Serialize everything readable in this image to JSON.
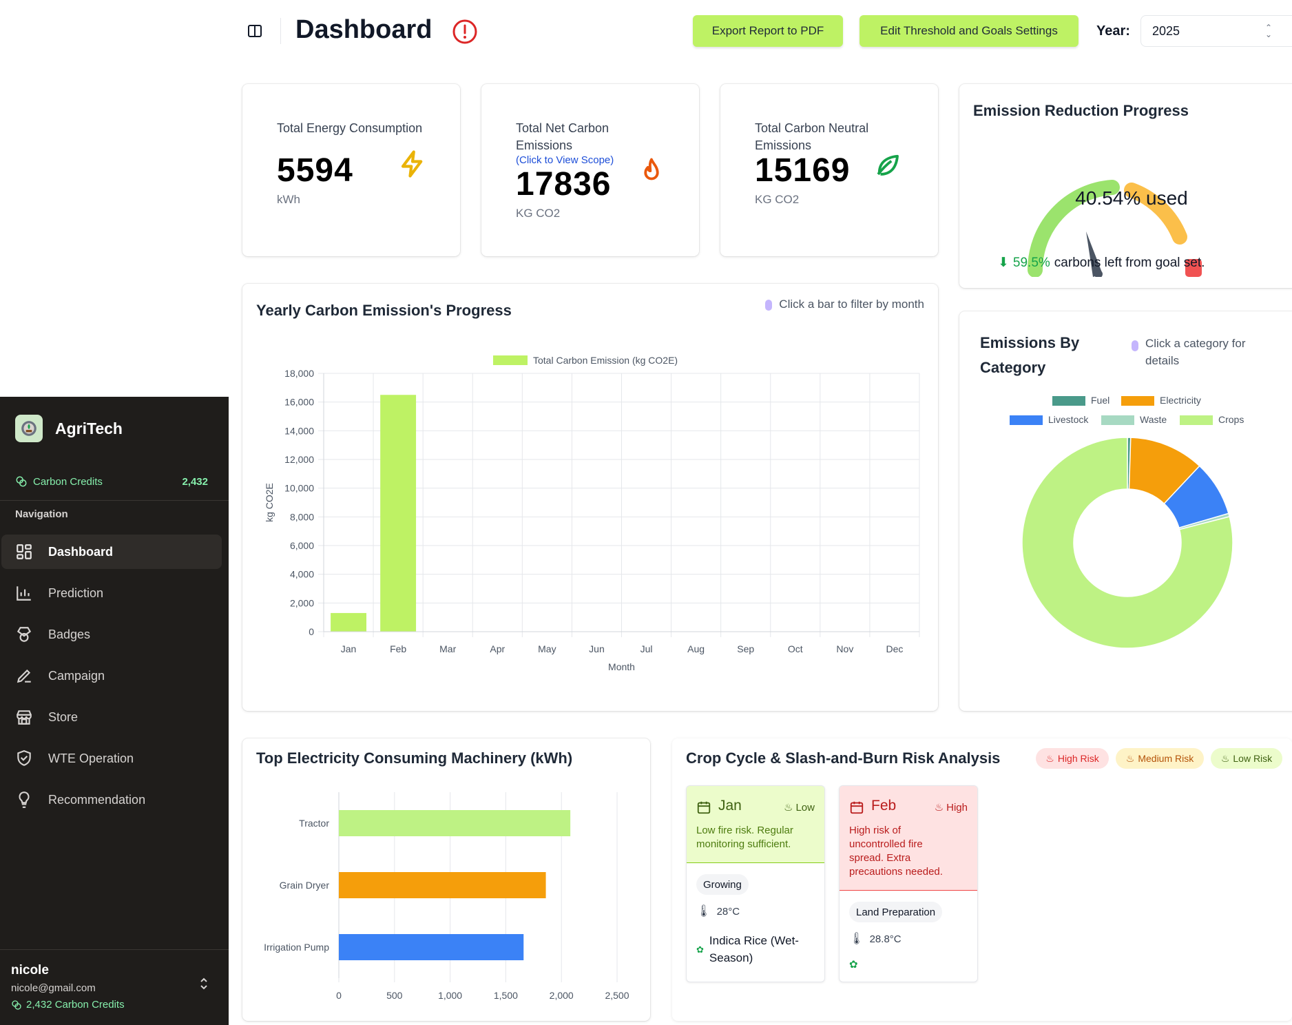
{
  "header": {
    "title": "Dashboard",
    "export_button": "Export Report to PDF",
    "settings_button": "Edit Threshold and Goals Settings",
    "year_label": "Year:",
    "year_value": "2025"
  },
  "sidebar": {
    "brand": "AgriTech",
    "credits_label": "Carbon Credits",
    "credits_value": "2,432",
    "nav_title": "Navigation",
    "items": [
      {
        "label": "Dashboard",
        "icon": "dashboard-icon",
        "active": true
      },
      {
        "label": "Prediction",
        "icon": "bar-chart-icon"
      },
      {
        "label": "Badges",
        "icon": "badge-icon"
      },
      {
        "label": "Campaign",
        "icon": "pen-icon"
      },
      {
        "label": "Store",
        "icon": "store-icon"
      },
      {
        "label": "WTE Operation",
        "icon": "handshake-shield-icon"
      },
      {
        "label": "Recommendation",
        "icon": "lightbulb-icon"
      }
    ],
    "user": {
      "name": "nicole",
      "email": "nicole@gmail.com",
      "credits": "2,432 Carbon Credits"
    }
  },
  "stats": {
    "energy": {
      "label": "Total Energy Consumption",
      "value": "5594",
      "unit": "kWh"
    },
    "net": {
      "label": "Total Net Carbon Emissions",
      "link": "(Click to View Scope)",
      "value": "17836",
      "unit": "KG CO2"
    },
    "neutral": {
      "label": "Total Carbon Neutral Emissions",
      "value": "15169",
      "unit": "KG CO2"
    }
  },
  "progress": {
    "title": "Emission Reduction Progress",
    "used_text": "40.54% used",
    "used_fraction": 0.4054,
    "left_pct": "59.5%",
    "left_text": "carbons left from goal set."
  },
  "yearly": {
    "title": "Yearly Carbon Emission's Progress",
    "hint": "Click a bar to filter by month"
  },
  "category": {
    "title_line1": "Emissions By",
    "title_line2": "Category",
    "hint": "Click a category for details"
  },
  "machinery": {
    "title": "Top Electricity Consuming Machinery (kWh)"
  },
  "crop": {
    "title": "Crop Cycle & Slash-and-Burn Risk Analysis",
    "pills": {
      "high": "High Risk",
      "medium": "Medium Risk",
      "low": "Low Risk"
    },
    "months": [
      {
        "month": "Jan",
        "level": "Low",
        "desc": "Low fire risk. Regular monitoring sufficient.",
        "stage": "Growing",
        "temp": "28°C",
        "crop": "Indica Rice (Wet-Season)"
      },
      {
        "month": "Feb",
        "level": "High",
        "desc": "High risk of uncontrolled fire spread. Extra precautions needed.",
        "stage": "Land Preparation",
        "temp": "28.8°C",
        "crop": ""
      }
    ]
  },
  "chart_data": [
    {
      "type": "bar",
      "title": "",
      "categories": [
        "Jan",
        "Feb",
        "Mar",
        "Apr",
        "May",
        "Jun",
        "Jul",
        "Aug",
        "Sep",
        "Oct",
        "Nov",
        "Dec"
      ],
      "series": [
        {
          "name": "Total Carbon Emission (kg CO2E)",
          "values": [
            1300,
            16500,
            0,
            0,
            0,
            0,
            0,
            0,
            0,
            0,
            0,
            0
          ],
          "color": "#bef264"
        }
      ],
      "xlabel": "Month",
      "ylabel": "kg CO2E",
      "ylim": [
        0,
        18000
      ],
      "yticks": [
        "0",
        "2,000",
        "4,000",
        "6,000",
        "8,000",
        "10,000",
        "12,000",
        "14,000",
        "16,000",
        "18,000"
      ],
      "grid": true,
      "legend": "top"
    },
    {
      "type": "pie",
      "title": "",
      "categories": [
        "Fuel",
        "Electricity",
        "Livestock",
        "Waste",
        "Crops"
      ],
      "values": [
        0.5,
        11.5,
        8.5,
        0.5,
        79
      ],
      "colors": [
        "#4a9a8a",
        "#f59e0b",
        "#3b82f6",
        "#a7d9c2",
        "#bef284"
      ],
      "legend": "top"
    },
    {
      "type": "bar",
      "orientation": "horizontal",
      "title": "",
      "categories": [
        "Tractor",
        "Grain Dryer",
        "Irrigation Pump"
      ],
      "values": [
        2080,
        1860,
        1660
      ],
      "colors": [
        "#bef284",
        "#f59e0b",
        "#3b82f6"
      ],
      "xlim": [
        0,
        2500
      ],
      "xticks": [
        "0",
        "500",
        "1,000",
        "1,500",
        "2,000",
        "2,500"
      ],
      "grid": true
    }
  ]
}
